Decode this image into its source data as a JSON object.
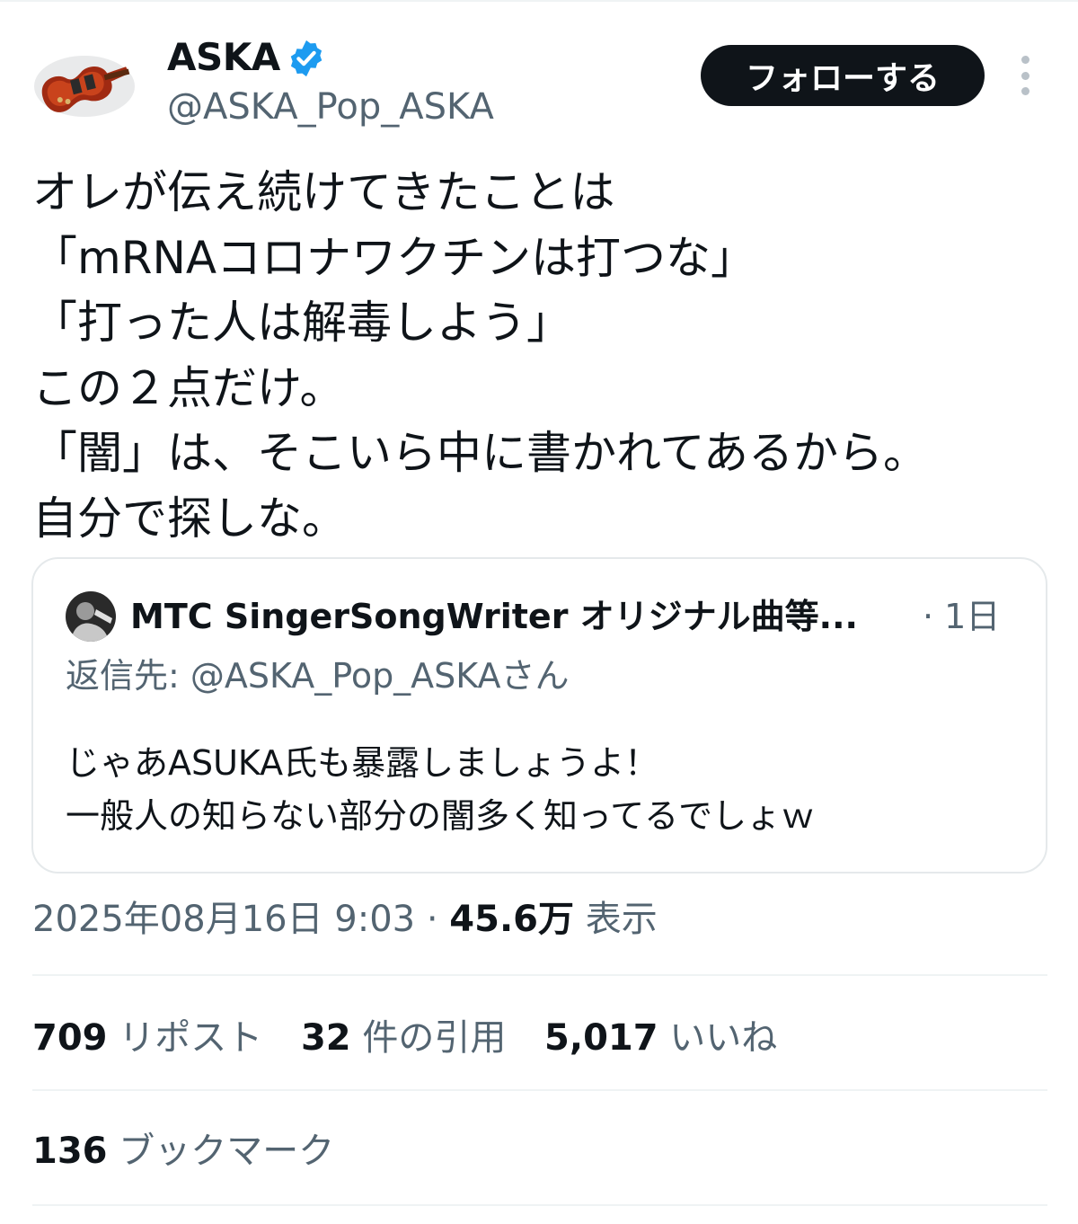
{
  "author": {
    "name": "ASKA",
    "handle": "@ASKA_Pop_ASKA",
    "verified_color": "#1d9bf0"
  },
  "actions": {
    "follow_label": "フォローする",
    "more_icon": "more-vertical-icon"
  },
  "tweet": {
    "text": "オレが伝え続けてきたことは\n「mRNAコロナワクチンは打つな」\n「打った人は解毒しよう」\nこの２点だけ。\n「闇」は、そこいら中に書かれてあるから。\n自分で探しな。"
  },
  "quote": {
    "author": "MTC SingerSongWriter オリジナル曲等...",
    "time": "· 1日",
    "reply_prefix": "返信先: ",
    "reply_handle": "@ASKA_Pop_ASKAさん",
    "text": "じゃあASUKA氏も暴露しましょうよ！\n一般人の知らない部分の闇多く知ってるでしょｗ"
  },
  "meta": {
    "timestamp": "2025年08月16日 9:03",
    "separator": " · ",
    "views": "45.6万",
    "views_label": " 表示"
  },
  "stats": {
    "reposts_num": "709",
    "reposts_label": " リポスト",
    "quotes_num": "32",
    "quotes_label": " 件の引用",
    "likes_num": "5,017",
    "likes_label": " いいね",
    "bookmarks_num": "136",
    "bookmarks_label": " ブックマーク"
  },
  "colors": {
    "text_primary": "#0f1419",
    "text_secondary": "#536471",
    "border": "#eff3f4",
    "button_bg": "#0f1419"
  }
}
